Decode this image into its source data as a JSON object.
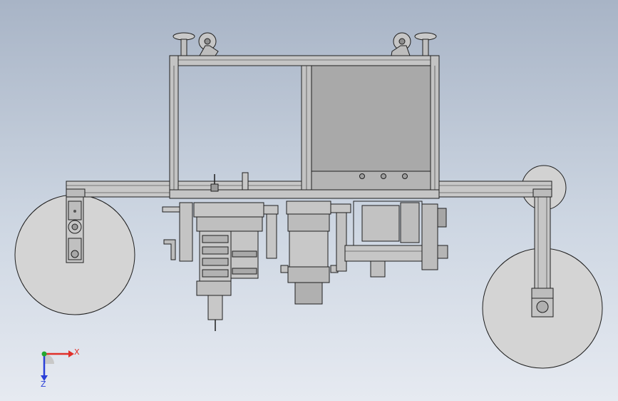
{
  "triad": {
    "x_label": "X",
    "z_label": "Z",
    "x_color": "#e0302a",
    "z_color": "#2a3fd8",
    "y_color": "#22a830"
  },
  "colors": {
    "background_top": "#a8b4c6",
    "background_bottom": "#e6eaf1",
    "part_fill": "#c3c3c3",
    "panel_fill": "#a9a9a9",
    "wheel_fill": "#d4d4d4",
    "edge": "#1f1f1f"
  }
}
